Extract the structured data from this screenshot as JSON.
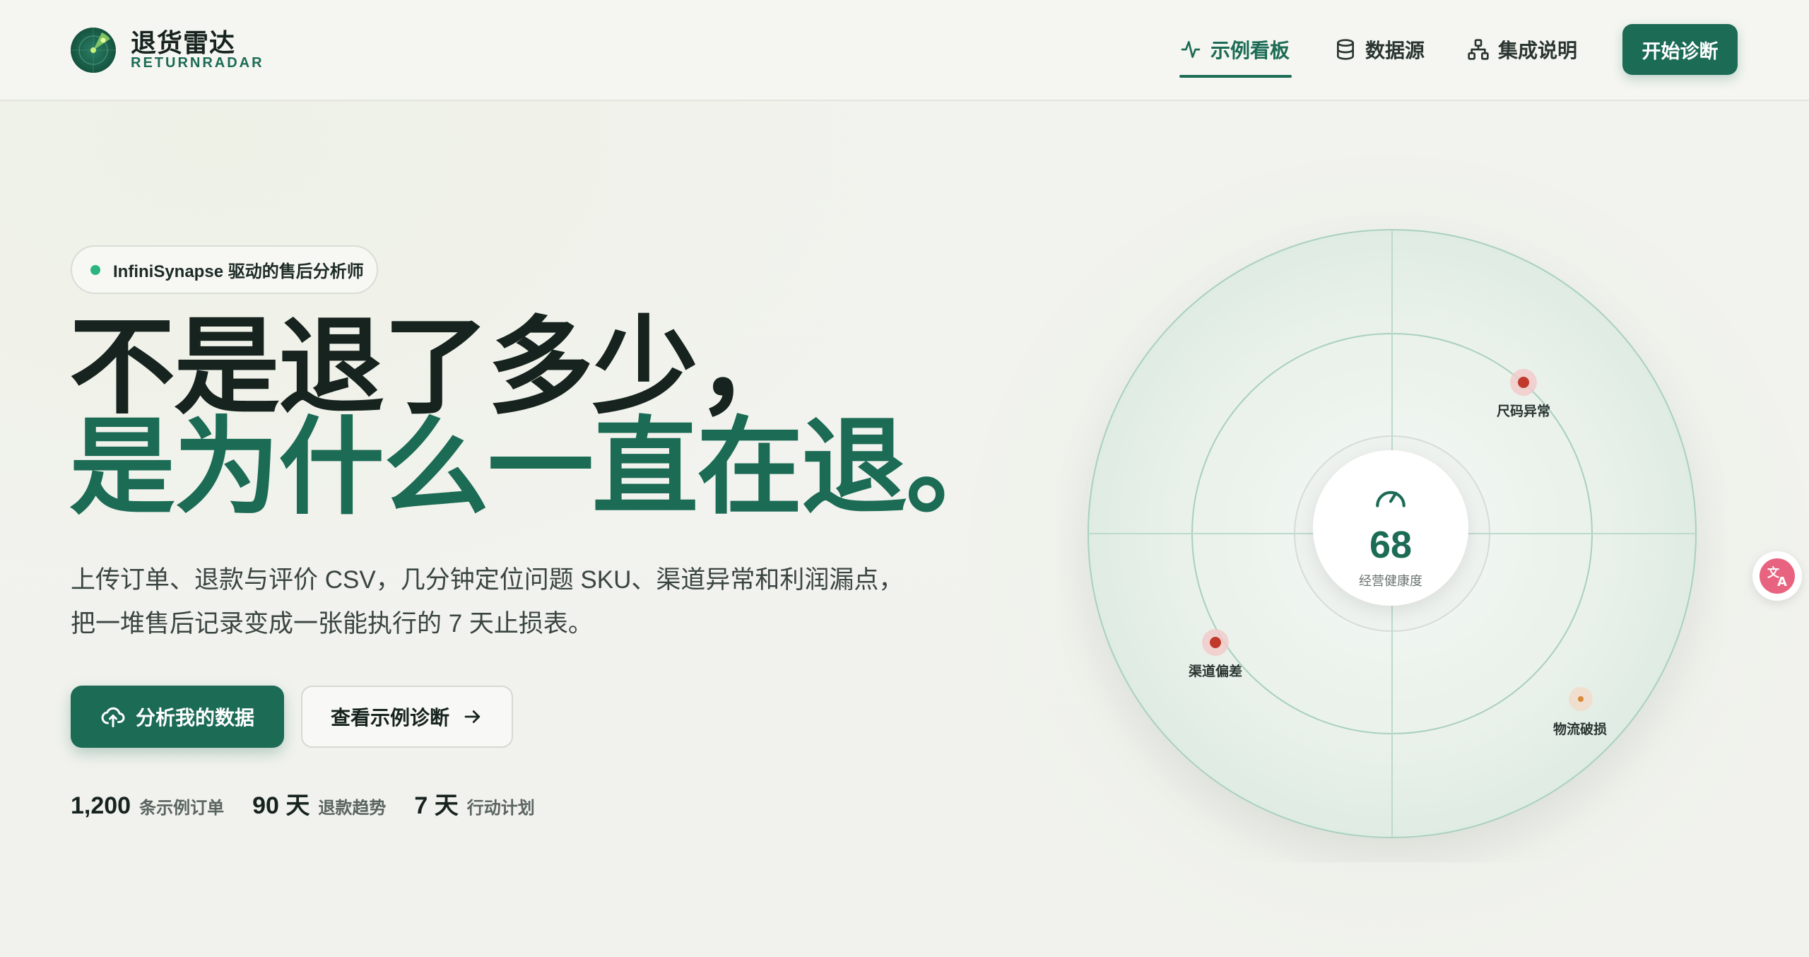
{
  "brand": {
    "name": "退货雷达",
    "sub": "RETURNRADAR"
  },
  "nav": {
    "items": [
      {
        "label": "示例看板",
        "icon": "activity-icon",
        "active": true
      },
      {
        "label": "数据源",
        "icon": "database-icon"
      },
      {
        "label": "集成说明",
        "icon": "hierarchy-icon"
      }
    ],
    "cta": "开始诊断"
  },
  "hero": {
    "badge": "InfiniSynapse 驱动的售后分析师",
    "headline_line1": "不是退了多少，",
    "headline_line2": "是为什么一直在退。",
    "desc_line1": "上传订单、退款与评价 CSV，几分钟定位问题 SKU、渠道异常和利润漏点，",
    "desc_line2": "把一堆售后记录变成一张能执行的 7 天止损表。",
    "primary_button": "分析我的数据",
    "secondary_button": "查看示例诊断",
    "stats": [
      {
        "value": "1,200",
        "label": "条示例订单"
      },
      {
        "value": "90 天",
        "label": "退款趋势"
      },
      {
        "value": "7 天",
        "label": "行动计划"
      }
    ]
  },
  "radar": {
    "score": "68",
    "score_label": "经营健康度",
    "points": [
      {
        "label": "尺码异常"
      },
      {
        "label": "渠道偏差"
      },
      {
        "label": "物流破损"
      }
    ]
  },
  "colors": {
    "brand_green": "#1b6b55",
    "alert_red": "#c0392b",
    "warning_orange": "#d78a3a",
    "badge_dot": "#2bb57e"
  }
}
